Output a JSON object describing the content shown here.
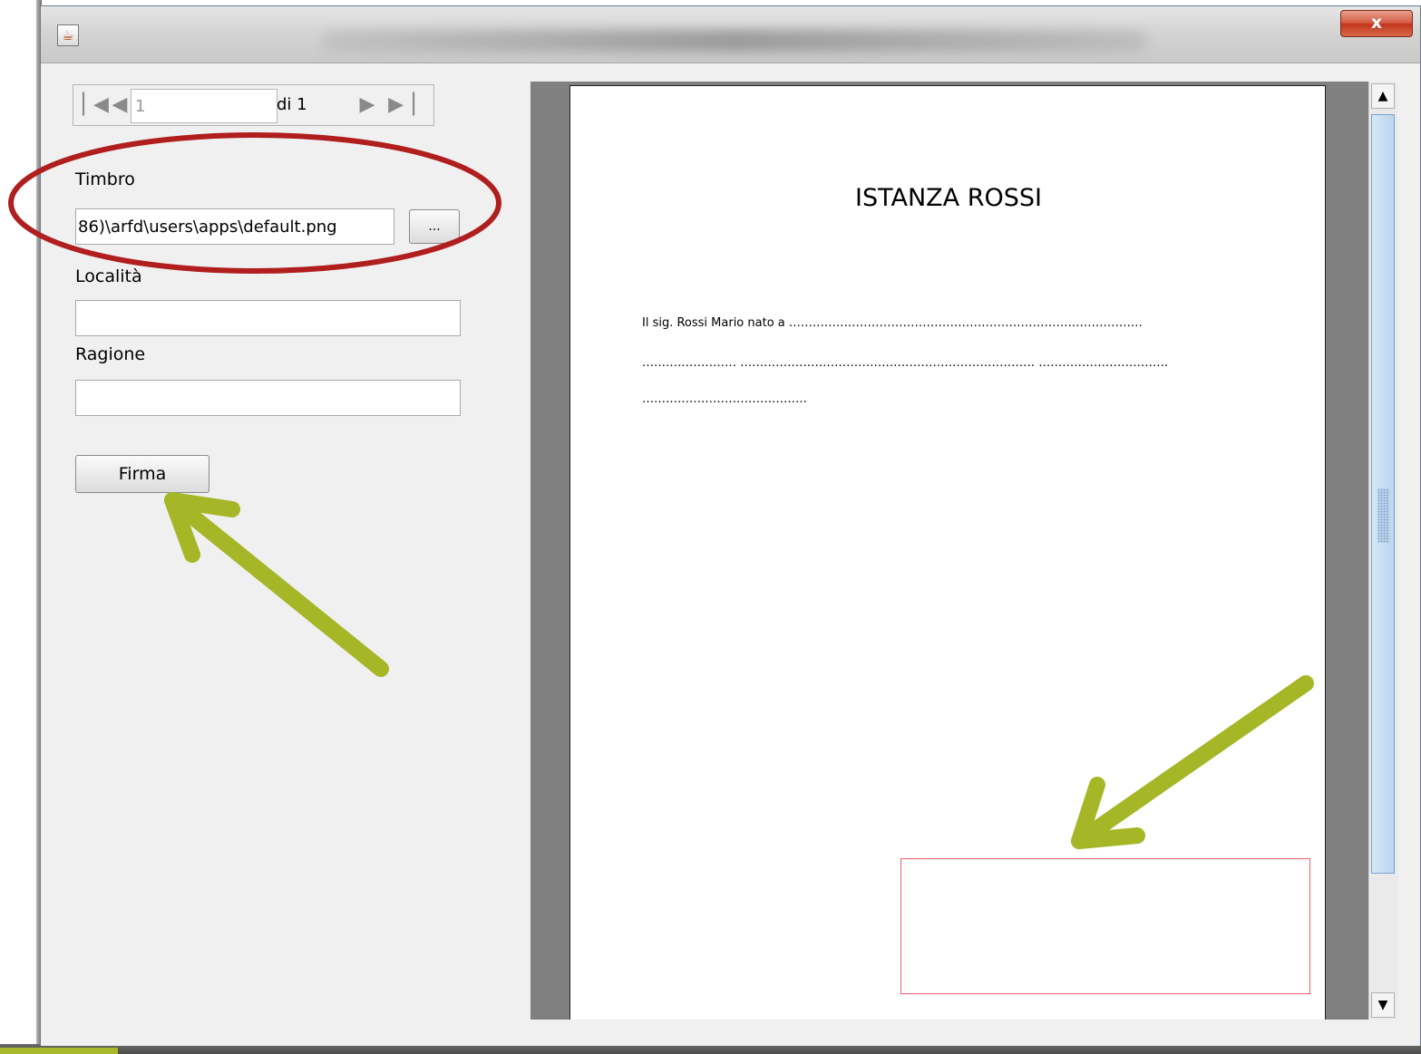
{
  "window": {
    "icon": "java-cup-icon",
    "close_label": "x"
  },
  "navigator": {
    "current_page": "1",
    "of_label": "di 1",
    "icons": [
      "first-page-icon",
      "previous-page-icon",
      "next-page-icon",
      "last-page-icon"
    ]
  },
  "form": {
    "timbro_label": "Timbro",
    "timbro_value": "86)\\arfd\\users\\apps\\default.png",
    "browse_label": "...",
    "localita_label": "Località",
    "localita_value": "",
    "ragione_label": "Ragione",
    "ragione_value": "",
    "firma_label": "Firma"
  },
  "document": {
    "title": "ISTANZA ROSSI",
    "line1": "Il sig. Rossi Mario nato a ………………………………………………………………………………",
    "line2": "…………………… ………………………………………………………………… ……………………………",
    "line3": "……………………………………"
  },
  "annotations": {
    "highlight_color": "#b01e1e",
    "arrow_color": "#a5b727",
    "signature_box_color": "#f05a6a"
  }
}
